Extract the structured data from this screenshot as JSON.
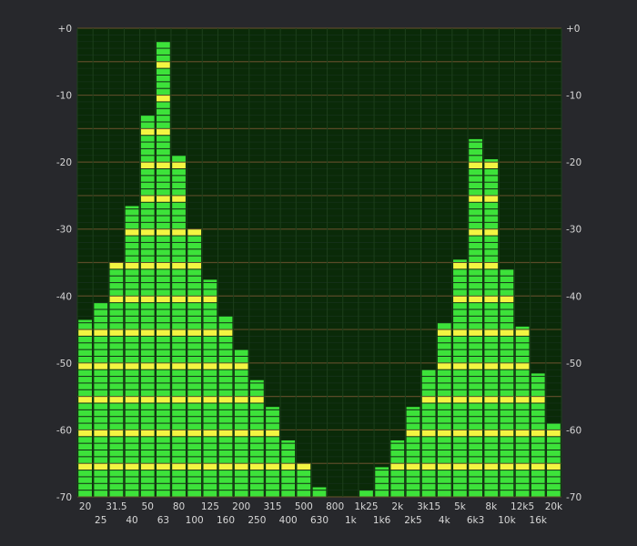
{
  "chart_data": {
    "type": "bar",
    "categories": [
      "20",
      "25",
      "31.5",
      "40",
      "50",
      "63",
      "80",
      "100",
      "125",
      "160",
      "200",
      "250",
      "315",
      "400",
      "500",
      "630",
      "800",
      "1k",
      "1k25",
      "1k6",
      "2k",
      "2k5",
      "3k15",
      "4k",
      "5k",
      "6k3",
      "8k",
      "10k",
      "12k5",
      "16k",
      "20k"
    ],
    "values": [
      -43.5,
      -41,
      -35,
      -26.5,
      -13,
      -2,
      -19,
      -30,
      -37.5,
      -43,
      -48,
      -52.5,
      -56.5,
      -61.5,
      -65,
      -68.5,
      -71,
      -71,
      -69,
      -65.5,
      -61.5,
      -56.5,
      -51,
      -44,
      -34.5,
      -16.5,
      -19.5,
      -36,
      -44.5,
      -51.5,
      -59
    ],
    "ylim": [
      -70,
      0
    ],
    "yticks": [
      0,
      -10,
      -20,
      -30,
      -40,
      -50,
      -60,
      -70
    ],
    "ytick_labels": [
      "+0",
      "-10",
      "-20",
      "-30",
      "-40",
      "-50",
      "-60",
      "-70"
    ],
    "segment_db": 1,
    "accent_every_db": 5,
    "grid": true,
    "colors": {
      "background": "#27282c",
      "plot_background": "#0a2a08",
      "segment": "#3de23a",
      "accent_segment": "#f3f542",
      "grid_line": "#5a4a28",
      "tick_text": "#d7d7d7"
    }
  }
}
